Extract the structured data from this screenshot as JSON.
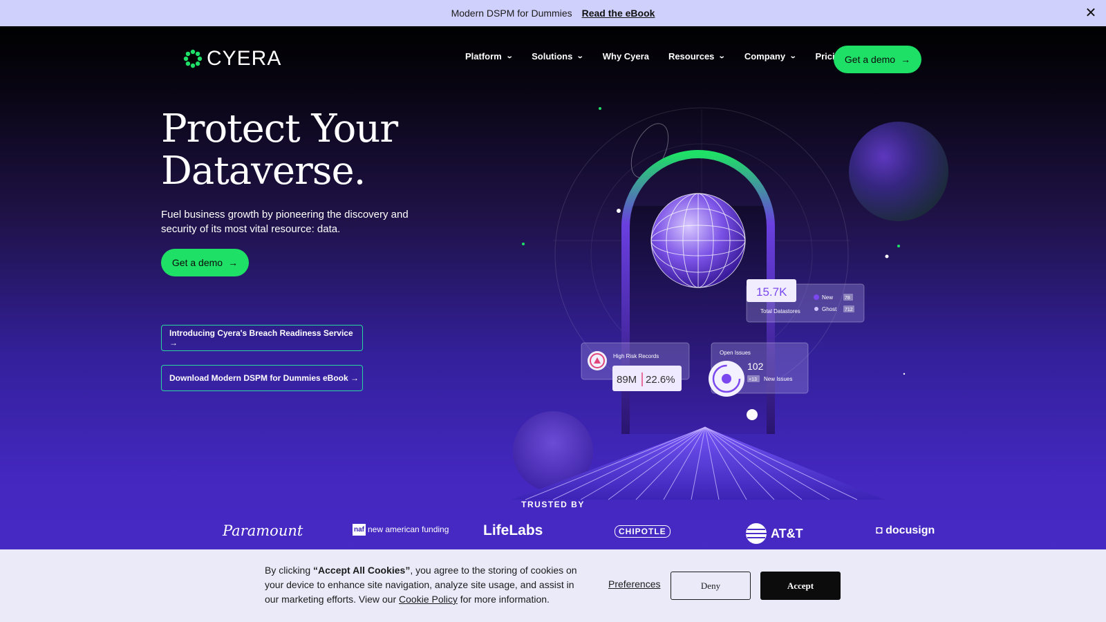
{
  "announcement": {
    "message": "Modern DSPM for Dummies",
    "link": "Read the eBook",
    "close_icon": "close-icon"
  },
  "nav": {
    "logo_text": "CYERA",
    "items": [
      {
        "label": "Platform",
        "has_dropdown": true
      },
      {
        "label": "Solutions",
        "has_dropdown": true
      },
      {
        "label": "Why Cyera",
        "has_dropdown": false
      },
      {
        "label": "Resources",
        "has_dropdown": true
      },
      {
        "label": "Company",
        "has_dropdown": true
      },
      {
        "label": "Pricing",
        "has_dropdown": false
      }
    ],
    "cta": "Get a demo",
    "arrow": "→"
  },
  "hero": {
    "title_line1": "Protect Your",
    "title_line2": "Dataverse.",
    "subtitle": "Fuel business growth by pioneering the discovery and security of its most vital resource: data.",
    "cta": "Get a demo",
    "arrow": "→",
    "link1": "Introducing Cyera's Breach Readiness Service →",
    "link2": "Download Modern DSPM for Dummies eBook →"
  },
  "stats": {
    "datastores_value": "15.7K",
    "datastores_label": "Total Datastores",
    "new_label": "New",
    "new_value": "78",
    "ghost_label": "Ghost",
    "ghost_value": "712",
    "risk_label": "High Risk Records",
    "risk_value": "89M",
    "risk_pct": "22.6%",
    "issues_label": "Open Issues",
    "issues_value": "102",
    "new_issues_badge": "+13",
    "new_issues_label": "New Issues"
  },
  "trusted": {
    "heading": "TRUSTED BY",
    "logos": [
      "Paramount",
      "new american funding",
      "LifeLabs",
      "CHIPOTLE",
      "AT&T",
      "docusign"
    ]
  },
  "cookie": {
    "text_prefix": "By clicking ",
    "text_bold": "“Accept All Cookies”",
    "text_middle": ", you agree to the storing of cookies on your device to enhance site navigation, analyze site usage, and assist in our marketing efforts. View our ",
    "policy_link": "Cookie Policy",
    "text_suffix": " for more information.",
    "preferences": "Preferences",
    "deny": "Deny",
    "accept": "Accept"
  },
  "colors": {
    "accent_green": "#1fe066",
    "banner_bg": "#cfd0fb",
    "cookie_bg": "#eaeaf9",
    "purple": "#4a2cc9"
  }
}
